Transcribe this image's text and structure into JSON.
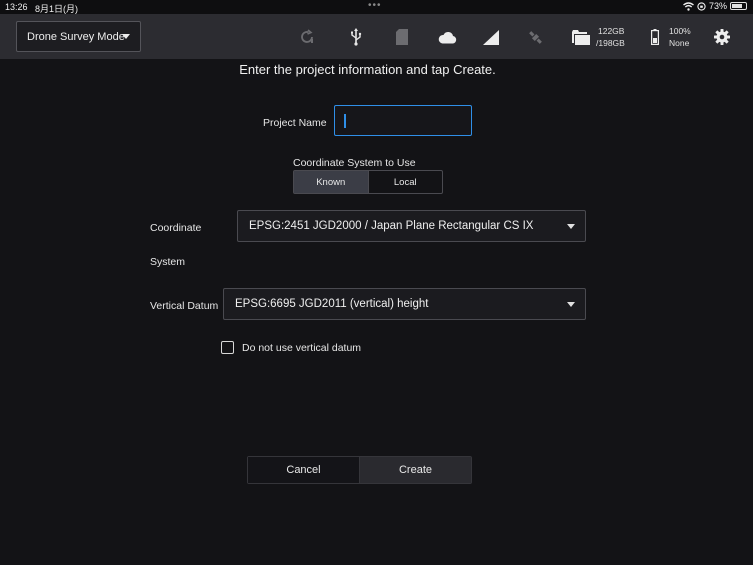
{
  "statusbar": {
    "time": "13:26",
    "date": "8月1日(月)",
    "battery_percent": "73%"
  },
  "toolbar": {
    "mode_label": "Drone Survey Mode",
    "storage_free": "122GB",
    "storage_total": "/198GB",
    "device_battery": "100%",
    "device_battery_sub": "None",
    "icons": [
      "refresh-icon",
      "usb-icon",
      "sd-card-icon",
      "cloud-icon",
      "signal-icon",
      "satellite-icon",
      "folder-icon",
      "battery-icon",
      "gear-icon"
    ]
  },
  "form": {
    "instruction": "Enter the project information and tap Create.",
    "project_name_label": "Project Name",
    "project_name_value": "",
    "coord_system_label": "Coordinate System to Use",
    "seg_known": "Known",
    "seg_local": "Local",
    "coordinate_label_line1": "Coordinate",
    "coordinate_label_line2": "System",
    "coordinate_value": "EPSG:2451 JGD2000 / Japan Plane Rectangular CS IX",
    "vertical_datum_label": "Vertical Datum",
    "vertical_datum_value": "EPSG:6695 JGD2011 (vertical) height",
    "no_vertical_label": "Do not use vertical datum",
    "no_vertical_checked": false,
    "cancel_label": "Cancel",
    "create_label": "Create"
  },
  "colors": {
    "accent": "#2f8fe8",
    "toolbar_bg": "#2c2c31",
    "page_bg": "#131316"
  }
}
